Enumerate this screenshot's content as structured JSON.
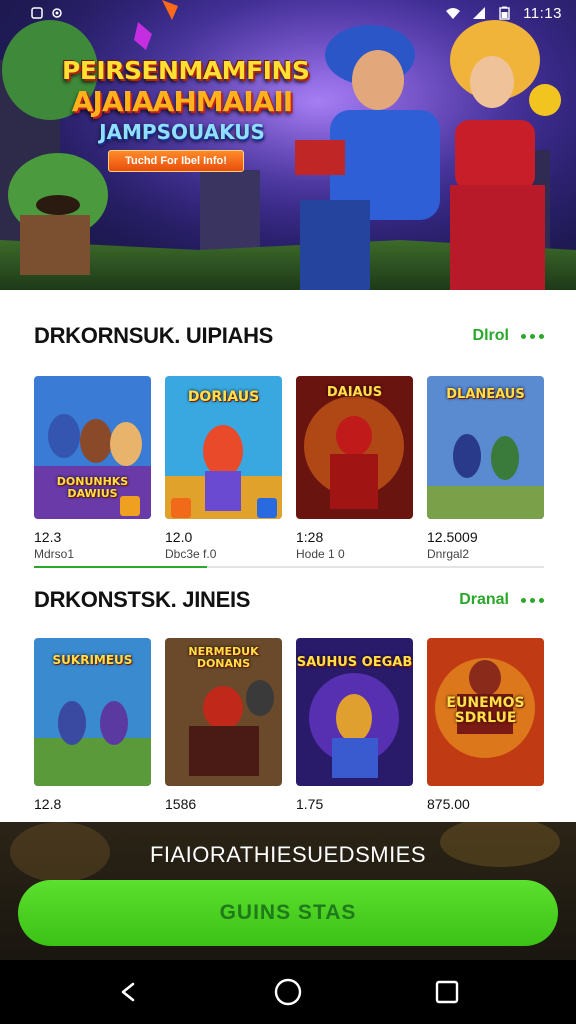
{
  "status_bar": {
    "left_icons": [
      "app-icon",
      "settings-icon"
    ],
    "right_icons": [
      "wifi-icon",
      "signal-icon",
      "battery-icon"
    ],
    "time": "11:13"
  },
  "hero": {
    "line1": "PEIRSENMAMFINS",
    "line2": "AJAIAAHMAIAII",
    "line3": "JAMPSOUAKUS",
    "button_label": "Tuchd For Ibel Info!"
  },
  "sections": [
    {
      "title": "DRKORNSUK. UIPIAHS",
      "more_label": "Dlrol",
      "progress": 0.34,
      "cards": [
        {
          "number": "12.3",
          "sub": "Mdrso1",
          "art_text": "DONUNHKS DAWIUS"
        },
        {
          "number": "12.0",
          "sub": "Dbc3e f.0",
          "art_text": "DORIAUS"
        },
        {
          "number": "1:28",
          "sub": "Hode 1 0",
          "art_text": "DAIAUS"
        },
        {
          "number": "12.5009",
          "sub": "Dnrgal2",
          "art_text": "DLANEAUS"
        }
      ]
    },
    {
      "title": "DRKONSTSK. JINEIS",
      "more_label": "Dranal",
      "progress": 0,
      "cards": [
        {
          "number": "12.8",
          "sub": "",
          "art_text": "SUKRIMEUS"
        },
        {
          "number": "1586",
          "sub": "",
          "art_text": "NERMEDUK DONANS"
        },
        {
          "number": "1.75",
          "sub": "",
          "art_text": "SAUHUS OEGAB"
        },
        {
          "number": "875.00",
          "sub": "",
          "art_text": "EUNEMOS SDRLUE"
        }
      ]
    }
  ],
  "bottom": {
    "caption": "FIAIORATHIESUEDSMIES",
    "cta_label": "GUINS STAS"
  },
  "nav": {
    "icons": [
      "back-icon",
      "home-icon",
      "recents-icon"
    ]
  },
  "colors": {
    "accent_green": "#2aa82a",
    "cta_green": "#4cd223",
    "hero_bg": "#3b2a8f"
  }
}
